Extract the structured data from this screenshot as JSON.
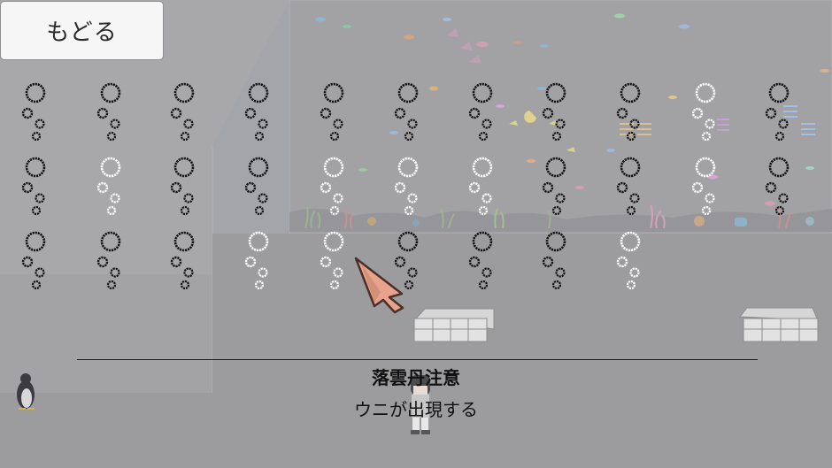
{
  "back_button": {
    "label": "もどる"
  },
  "caption": {
    "title": "落雲丹注意",
    "description": "ウニが出現する"
  },
  "bubble_grid": {
    "rows": [
      [
        "dark",
        "dark",
        "dark",
        "dark",
        "dark",
        "dark",
        "dark",
        "dark",
        "dark",
        "white",
        "dark"
      ],
      [
        "dark",
        "white",
        "dark",
        "dark",
        "white",
        "white",
        "white",
        "dark",
        "dark",
        "white",
        "dark"
      ],
      [
        "dark",
        "dark",
        "dark",
        "white",
        "white",
        "dark",
        "dark",
        "dark",
        "white"
      ]
    ]
  },
  "colors": {
    "floor": "#9c9c9e",
    "back_wall": "#a8a8aa",
    "left_wall": "#9a9a9d",
    "side_panel": "#a2a2a8",
    "tank_water": "#a2a2a5",
    "arrow_fill": "#e7a38c",
    "arrow_outline": "#4a3028",
    "bubble_dark": "#141414",
    "bubble_white": "#ffffff"
  }
}
